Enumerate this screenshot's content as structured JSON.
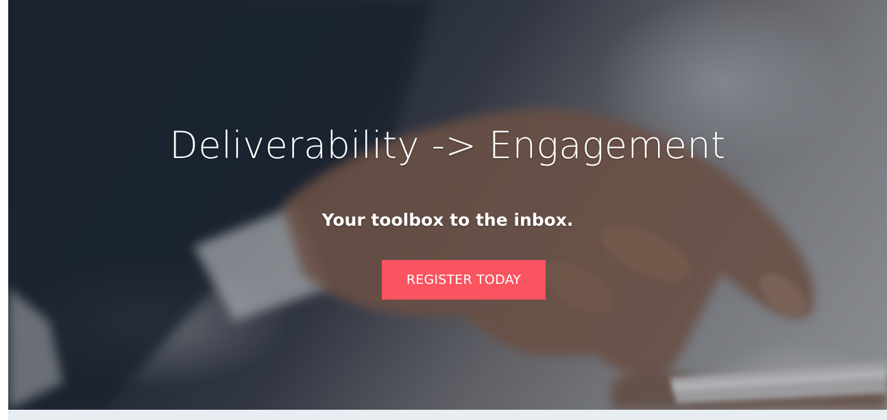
{
  "hero": {
    "title": "Deliverability -> Engagement",
    "subtitle": "Your toolbox to the inbox.",
    "cta_label": "REGISTER TODAY",
    "background_image": "businessman-hand-tapping-smartphone-photo"
  },
  "colors": {
    "cta_background": "#f9545f",
    "text": "#ffffff",
    "footer_strip": "#e8edf2"
  }
}
